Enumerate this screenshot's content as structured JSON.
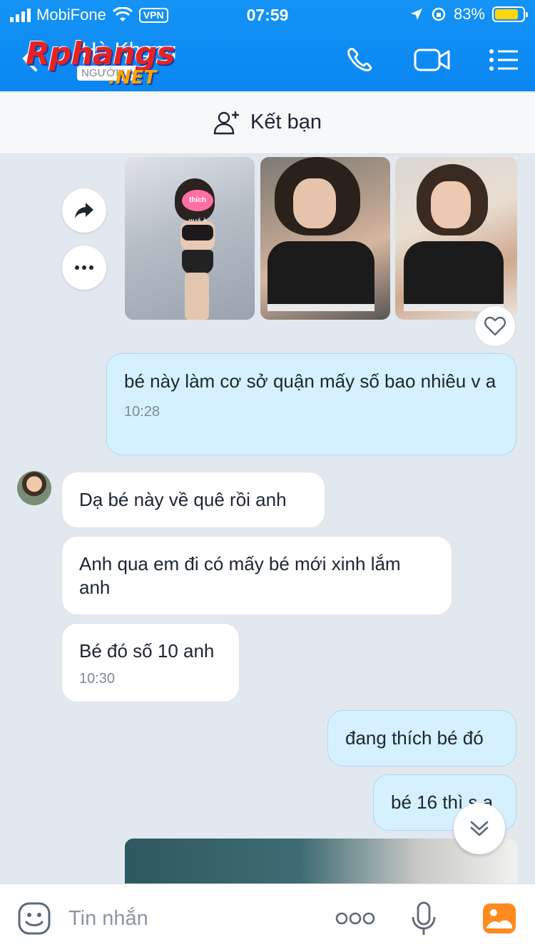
{
  "status_bar": {
    "carrier": "MobiFone",
    "vpn": "VPN",
    "time": "07:59",
    "battery_percent": "83%",
    "battery_level": 0.83
  },
  "header": {
    "contact_name": "Hà Khang",
    "contact_subtitle": "NGƯỜI LẠ",
    "watermark_line1": "Rphangs",
    "watermark_line2": ".NET",
    "call_icon": "phone-icon",
    "video_icon": "video-call-icon",
    "menu_icon": "menu-icon"
  },
  "friend_bar": {
    "label": "Kết bạn",
    "icon": "add-friend-icon"
  },
  "photo_strip": {
    "sticker_text": "thích quá à",
    "actions": [
      "share-icon",
      "more-icon",
      "heart-icon"
    ]
  },
  "messages": [
    {
      "side": "out",
      "text": "bé này làm cơ sở quận mấy số bao nhiêu v a",
      "time": "10:28"
    },
    {
      "side": "in",
      "text": "Dạ bé này về quê rồi anh",
      "time": ""
    },
    {
      "side": "in",
      "text": "Anh qua em đi có mấy bé mới xinh lắm anh",
      "time": ""
    },
    {
      "side": "in",
      "text": "Bé đó số 10 anh",
      "time": "10:30"
    },
    {
      "side": "out",
      "text": "đang thích bé đó",
      "time": ""
    },
    {
      "side": "out",
      "text": "bé 16 thì s a",
      "time": ""
    }
  ],
  "composer": {
    "placeholder": "Tin nhắn",
    "icons": [
      "emoji-icon",
      "more-options-icon",
      "microphone-icon",
      "gallery-icon"
    ]
  },
  "colors": {
    "header_blue": "#0b86f2",
    "outgoing_bubble": "#d5f1ff",
    "incoming_bubble": "#ffffff",
    "chat_background": "#e2e8ef"
  }
}
